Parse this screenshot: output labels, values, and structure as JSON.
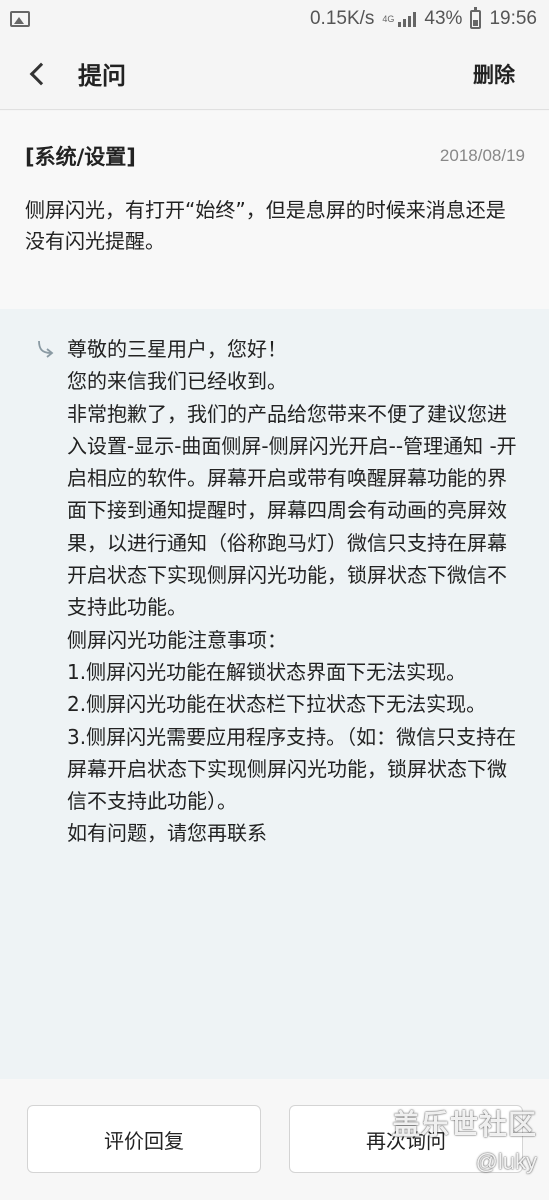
{
  "status_bar": {
    "network_speed": "0.15K/s",
    "network_type": "4G",
    "battery": "43%",
    "time": "19:56"
  },
  "header": {
    "title": "提问",
    "delete_label": "删除"
  },
  "question": {
    "category": "[系统/设置]",
    "date": "2018/08/19",
    "body": "侧屏闪光，有打开“始终”，但是息屏的时候来消息还是没有闪光提醒。"
  },
  "answer": {
    "paragraphs": [
      "尊敬的三星用户，您好！",
      "您的来信我们已经收到。",
      "非常抱歉了，我们的产品给您带来不便了建议您进入设置-显示-曲面侧屏-侧屏闪光开启--管理通知 -开启相应的软件。屏幕开启或带有唤醒屏幕功能的界面下接到通知提醒时，屏幕四周会有动画的亮屏效果，以进行通知（俗称跑马灯）微信只支持在屏幕开启状态下实现侧屏闪光功能，锁屏状态下微信不支持此功能。",
      "侧屏闪光功能注意事项：",
      "1.侧屏闪光功能在解锁状态界面下无法实现。",
      "2.侧屏闪光功能在状态栏下拉状态下无法实现。",
      "3.侧屏闪光需要应用程序支持。（如：微信只支持在屏幕开启状态下实现侧屏闪光功能，锁屏状态下微信不支持此功能）。",
      "如有问题，请您再联系"
    ]
  },
  "buttons": {
    "rate_label": "评价回复",
    "ask_again_label": "再次询问"
  },
  "watermark": {
    "site": "盖乐世社区",
    "user": "@luky"
  }
}
